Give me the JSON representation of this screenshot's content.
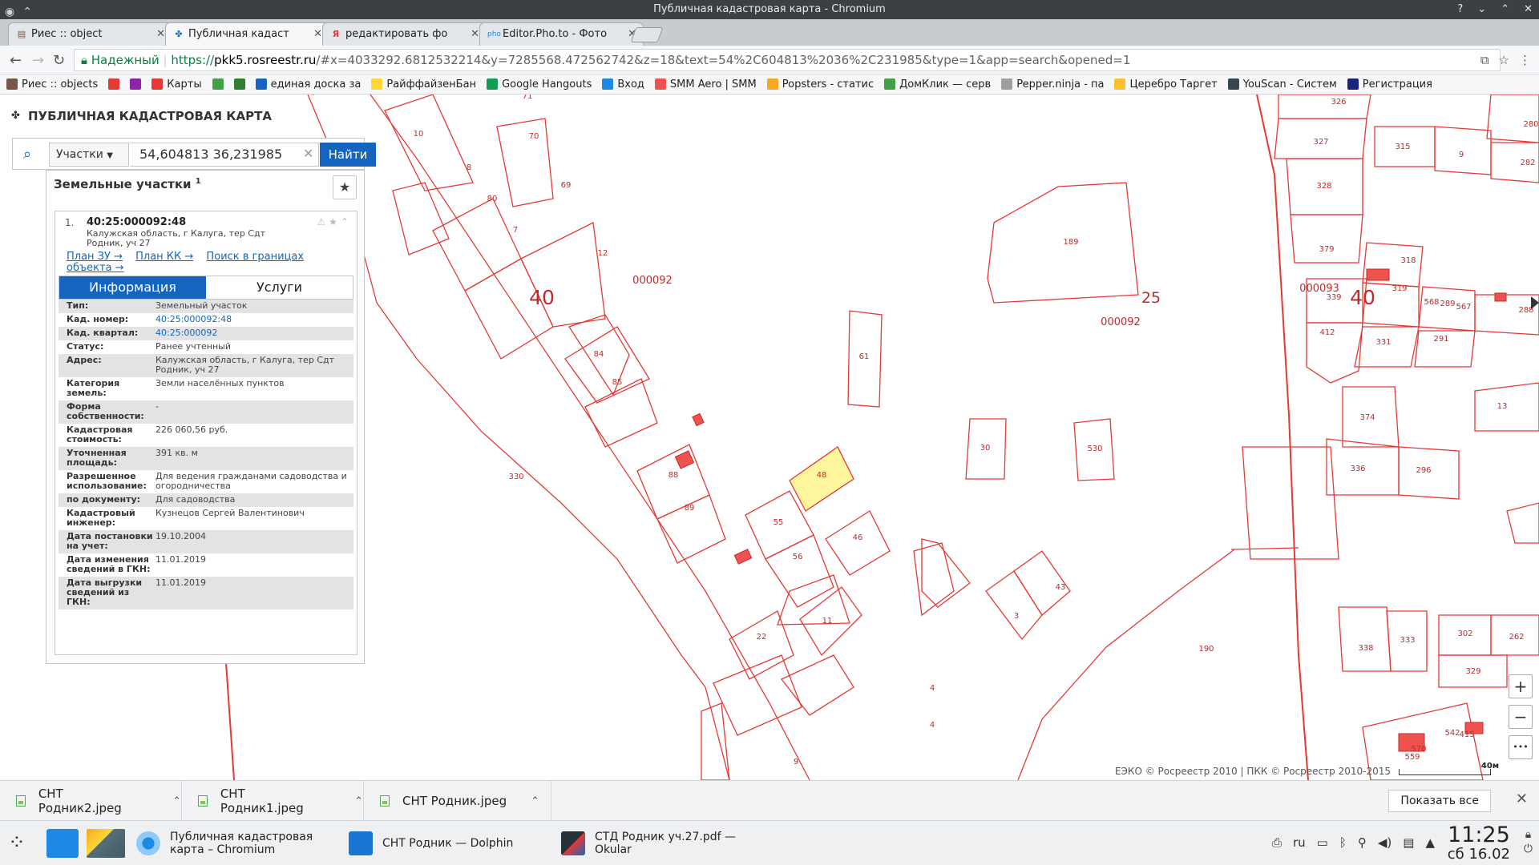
{
  "window": {
    "title": "Публичная кадастровая карта - Chromium"
  },
  "tabs": [
    {
      "label": "Риес :: object",
      "icon": "doc-icon"
    },
    {
      "label": "Публичная кадаст",
      "icon": "rosreestr-icon"
    },
    {
      "label": "редактировать фо",
      "icon": "yandex-icon"
    },
    {
      "label": "Editor.Pho.to - Фото",
      "icon": "phototo-icon"
    }
  ],
  "toolbar": {
    "secure_label": "Надежный",
    "url_scheme": "https://",
    "url_host": "pkk5.rosreestr.ru",
    "url_rest": "/#x=4033292.6812532214&y=7285568.472562742&z=18&text=54%2C604813%2036%2C231985&type=1&app=search&opened=1"
  },
  "bookmarks": [
    {
      "label": "Риес :: objects",
      "color": "#795548"
    },
    {
      "label": "",
      "color": "#e53935"
    },
    {
      "label": "",
      "color": "#8e24aa"
    },
    {
      "label": "Карты",
      "color": "#e53935"
    },
    {
      "label": "",
      "color": "#43a047"
    },
    {
      "label": "",
      "color": "#2e7d32"
    },
    {
      "label": "единая доска за",
      "color": "#1565c0"
    },
    {
      "label": "РайффайзенБан",
      "color": "#fdd835"
    },
    {
      "label": "Google Hangouts",
      "color": "#0f9d58"
    },
    {
      "label": "Вход",
      "color": "#1e88e5"
    },
    {
      "label": "SMM Aero | SMM",
      "color": "#ef5350"
    },
    {
      "label": "Popsters - статис",
      "color": "#f9a825"
    },
    {
      "label": "ДомКлик — серв",
      "color": "#43a047"
    },
    {
      "label": "Pepper.ninja - па",
      "color": "#9e9e9e"
    },
    {
      "label": "Церебро Таргет",
      "color": "#fbc02d"
    },
    {
      "label": "YouScan - Систем",
      "color": "#37474f"
    },
    {
      "label": "Регистрация",
      "color": "#1a237e"
    }
  ],
  "portal": {
    "title": "ПУБЛИЧНАЯ КАДАСТРОВАЯ КАРТА"
  },
  "search": {
    "type_label": "Участки",
    "query": "54,604813 36,231985",
    "button": "Найти"
  },
  "results": {
    "heading": "Земельные участки",
    "count": "1",
    "item": {
      "number": "1.",
      "cad_number": "40:25:000092:48",
      "address": "Калужская область, г Калуга, тер Сдт Родник, уч 27",
      "link_plan_zu": "План ЗУ →",
      "link_plan_kk": "План КК →",
      "link_search": "Поиск в границах объекта →"
    },
    "tab_info": "Информация",
    "tab_services": "Услуги",
    "rows": [
      {
        "k": "Тип:",
        "v": "Земельный участок",
        "link": false
      },
      {
        "k": "Кад. номер:",
        "v": "40:25:000092:48",
        "link": true
      },
      {
        "k": "Кад. квартал:",
        "v": "40:25:000092",
        "link": true
      },
      {
        "k": "Статус:",
        "v": "Ранее учтенный",
        "link": false
      },
      {
        "k": "Адрес:",
        "v": "Калужская область, г Калуга, тер Сдт Родник, уч 27",
        "link": false
      },
      {
        "k": "Категория земель:",
        "v": "Земли населённых пунктов",
        "link": false
      },
      {
        "k": "Форма собственности:",
        "v": "-",
        "link": false
      },
      {
        "k": "Кадастровая стоимость:",
        "v": "226 060,56 руб.",
        "link": false
      },
      {
        "k": "Уточненная площадь:",
        "v": "391 кв. м",
        "link": false
      },
      {
        "k": "Разрешенное использование:",
        "v": "Для ведения гражданами садоводства и огородничества",
        "link": false
      },
      {
        "k": "по документу:",
        "v": "Для садоводства",
        "link": false
      },
      {
        "k": "Кадастровый инженер:",
        "v": "Кузнецов Сергей Валентинович",
        "link": false
      },
      {
        "k": "Дата постановки на учет:",
        "v": "19.10.2004",
        "link": false
      },
      {
        "k": "Дата изменения сведений в ГКН:",
        "v": "11.01.2019",
        "link": false
      },
      {
        "k": "Дата выгрузки сведений из ГКН:",
        "v": "11.01.2019",
        "link": false
      }
    ]
  },
  "map": {
    "attribution": "ЕЭКО © Росреестр 2010 | ПКК © Росреестр 2010-2015",
    "scale_label": "40м",
    "zoom_in": "+",
    "zoom_out": "−",
    "more": "•••",
    "big_labels": [
      "40",
      "25",
      "40"
    ],
    "quarter_labels": [
      "000092",
      "000092",
      "000093"
    ],
    "parcel_labels": [
      "71",
      "70",
      "10",
      "8",
      "69",
      "80",
      "7",
      "12",
      "84",
      "85",
      "88",
      "89",
      "48",
      "55",
      "56",
      "46",
      "22",
      "11",
      "330",
      "61",
      "30",
      "530",
      "189",
      "43",
      "3",
      "4",
      "4",
      "190",
      "9",
      "326",
      "280",
      "327",
      "315",
      "9",
      "282",
      "328",
      "379",
      "318",
      "319",
      "339",
      "568",
      "289",
      "567",
      "288",
      "412",
      "331",
      "291",
      "374",
      "13",
      "336",
      "296",
      "338",
      "333",
      "302",
      "262",
      "329",
      "415",
      "542",
      "559",
      "570"
    ],
    "selected_color": "#fff59d",
    "line_color": "#e53935"
  },
  "downloads": [
    {
      "name": "СНТ Родник2.jpeg"
    },
    {
      "name": "СНТ Родник1.jpeg"
    },
    {
      "name": "СНТ Родник.jpeg"
    }
  ],
  "downloads_show_all": "Показать все",
  "taskbar": {
    "apps": [
      {
        "label": "Публичная кадастровая карта – Chromium"
      },
      {
        "label": "СНТ Родник — Dolphin"
      },
      {
        "label": "СТД Родник уч.27.pdf — Okular"
      }
    ],
    "keyboard_layout": "ru",
    "time": "11:25",
    "date": "сб 16.02"
  }
}
